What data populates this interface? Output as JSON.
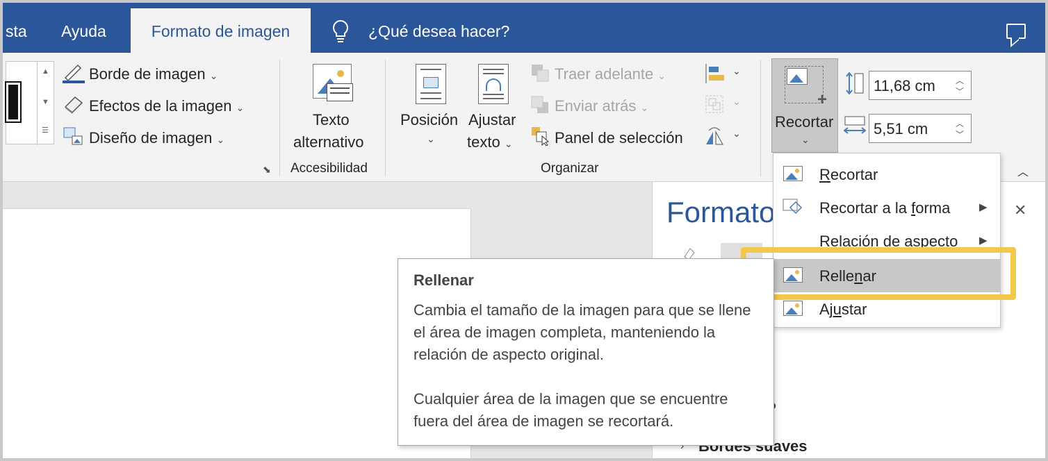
{
  "tabs": {
    "partial": "sta",
    "help": "Ayuda",
    "active": "Formato de imagen",
    "tell_me": "¿Qué desea hacer?"
  },
  "ribbon": {
    "picture_styles": {
      "border": "Borde de imagen",
      "effects": "Efectos de la imagen",
      "layout": "Diseño de imagen"
    },
    "accessibility": {
      "alt_text_line1": "Texto",
      "alt_text_line2": "alternativo",
      "group_label": "Accesibilidad"
    },
    "arrange": {
      "position": "Posición",
      "wrap_line1": "Ajustar",
      "wrap_line2": "texto",
      "bring_forward": "Traer adelante",
      "send_backward": "Enviar atrás",
      "selection_pane": "Panel de selección",
      "group_label": "Organizar"
    },
    "size": {
      "crop": "Recortar",
      "height": "11,68 cm",
      "width": "5,51 cm"
    }
  },
  "crop_menu": {
    "items": [
      {
        "label": "Recortar",
        "underline": "R",
        "rest": "ecortar",
        "prefix": ""
      },
      {
        "label": "Recortar a la forma",
        "prefix": "Recortar a la ",
        "underline": "f",
        "rest": "orma"
      },
      {
        "label": "Relación de aspecto",
        "prefix": "",
        "underline": "",
        "rest": "Relación de aspecto"
      },
      {
        "label": "Rellenar",
        "prefix": "Relle",
        "underline": "n",
        "rest": "ar"
      },
      {
        "label": "Ajustar",
        "prefix": "Aj",
        "underline": "u",
        "rest": "star"
      }
    ]
  },
  "tooltip": {
    "title": "Rellenar",
    "para1": "Cambia el tamaño de la imagen para que se llene el área de imagen completa, manteniendo la relación de aspecto original.",
    "para2": "Cualquier área de la imagen que se encuentre fuera del área de imagen se recortará."
  },
  "pane": {
    "title": "Formato",
    "section": "Bordes suaves",
    "partial_section": "o"
  },
  "colors": {
    "brand": "#2b579a",
    "highlight": "#f2c94c",
    "hover": "#c8c8c8"
  }
}
